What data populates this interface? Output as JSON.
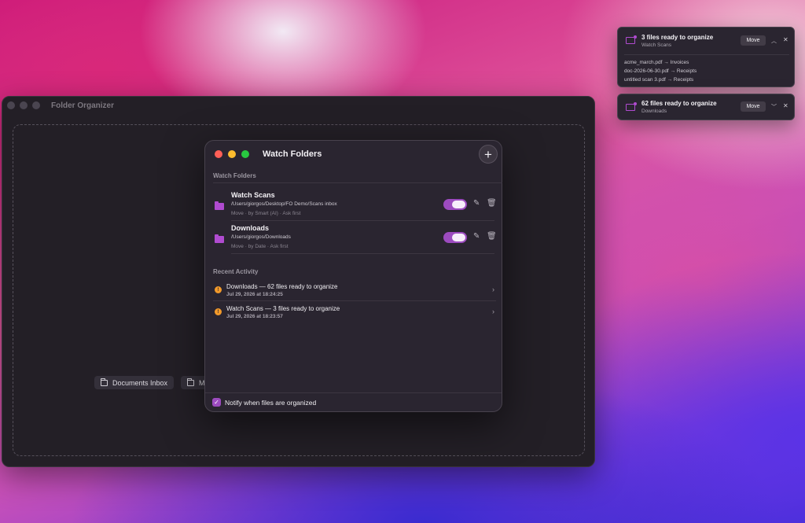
{
  "main_window": {
    "title": "Folder Organizer",
    "chips": [
      "Documents Inbox",
      "M"
    ]
  },
  "panel": {
    "title": "Watch Folders",
    "add_label": "+",
    "section_watch": "Watch Folders",
    "folders": [
      {
        "name": "Watch Scans",
        "path": "/Users/giorgos/Desktop/FO Demo/Scans inbox",
        "rule": "Move · by Smart (AI) · Ask first",
        "enabled": true
      },
      {
        "name": "Downloads",
        "path": "/Users/giorgos/Downloads",
        "rule": "Move · by Date · Ask first",
        "enabled": true
      }
    ],
    "section_activity": "Recent Activity",
    "activity": [
      {
        "title": "Downloads — 62 files ready to organize",
        "date": "Jul 29, 2026 at 18:24:25"
      },
      {
        "title": "Watch Scans — 3 files ready to organize",
        "date": "Jul 29, 2026 at 18:23:57"
      }
    ],
    "footer_label": "Notify when files are organized",
    "notify_checked": true
  },
  "notifications": [
    {
      "title": "3 files ready to organize",
      "subtitle": "Watch Scans",
      "button": "Move",
      "expanded": true,
      "files": [
        {
          "name": "acme_march.pdf",
          "dest": "Invoices"
        },
        {
          "name": "doc-2026-06-30.pdf",
          "dest": "Receipts"
        },
        {
          "name": "untitled scan 3.pdf",
          "dest": "Receipts"
        }
      ]
    },
    {
      "title": "62 files ready to organize",
      "subtitle": "Downloads",
      "button": "Move",
      "expanded": false
    }
  ],
  "colors": {
    "accent": "#9c4bbf",
    "warning": "#f39a2a"
  }
}
